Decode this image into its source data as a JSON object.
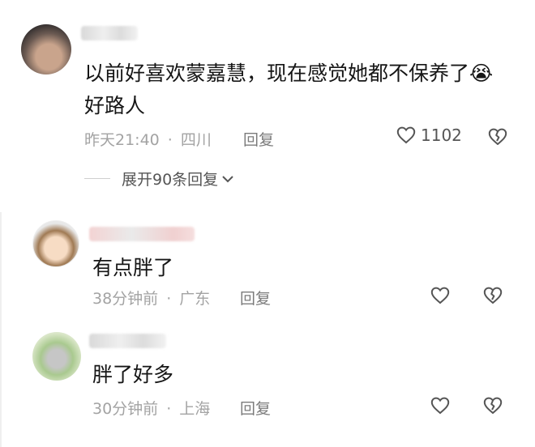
{
  "comments": [
    {
      "text_line1": "以前好喜欢蒙嘉慧，现在感觉她都不保养了",
      "emoji": "😭",
      "text_line2": "好路人",
      "time": "昨天21:40",
      "location": "四川",
      "reply_label": "回复",
      "like_count": "1102"
    },
    {
      "text": "有点胖了",
      "time": "38分钟前",
      "location": "广东",
      "reply_label": "回复"
    },
    {
      "text": "胖了好多",
      "time": "30分钟前",
      "location": "上海",
      "reply_label": "回复"
    }
  ],
  "expand_replies": "展开90条回复",
  "meta_separator": "·",
  "icons": {
    "like": "heart-icon",
    "dislike": "broken-heart-icon",
    "expand": "chevron-down-icon"
  }
}
